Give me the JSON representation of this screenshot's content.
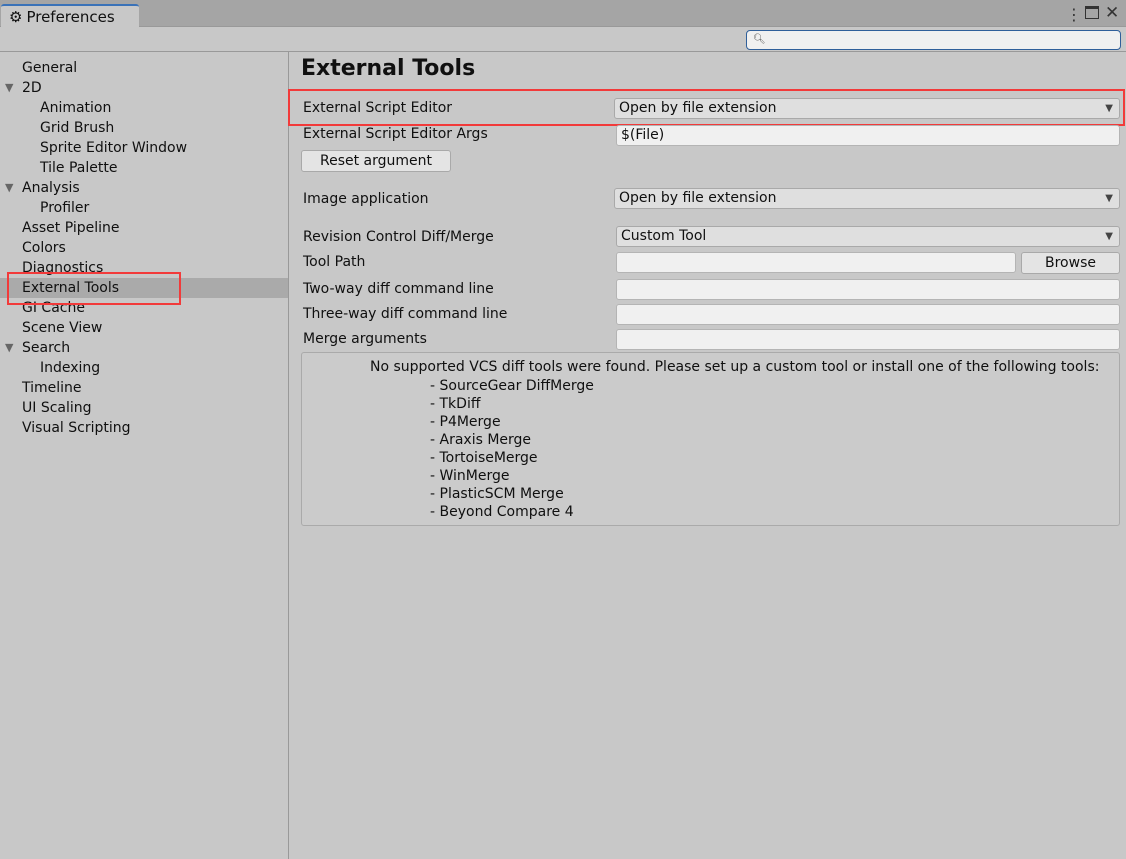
{
  "window": {
    "title": "Preferences",
    "icons": [
      "gear-icon",
      "more-icon",
      "maximize-icon",
      "close-icon"
    ]
  },
  "search": {
    "placeholder": "",
    "icon": "search-icon"
  },
  "sidebar": {
    "items": [
      {
        "label": "General",
        "indent": 0
      },
      {
        "label": "2D",
        "indent": 0,
        "expanded": true
      },
      {
        "label": "Animation",
        "indent": 1
      },
      {
        "label": "Grid Brush",
        "indent": 1
      },
      {
        "label": "Sprite Editor Window",
        "indent": 1
      },
      {
        "label": "Tile Palette",
        "indent": 1
      },
      {
        "label": "Analysis",
        "indent": 0,
        "expanded": true
      },
      {
        "label": "Profiler",
        "indent": 1
      },
      {
        "label": "Asset Pipeline",
        "indent": 0
      },
      {
        "label": "Colors",
        "indent": 0
      },
      {
        "label": "Diagnostics",
        "indent": 0
      },
      {
        "label": "External Tools",
        "indent": 0,
        "selected": true
      },
      {
        "label": "GI Cache",
        "indent": 0
      },
      {
        "label": "Scene View",
        "indent": 0
      },
      {
        "label": "Search",
        "indent": 0,
        "expanded": true
      },
      {
        "label": "Indexing",
        "indent": 1
      },
      {
        "label": "Timeline",
        "indent": 0
      },
      {
        "label": "UI Scaling",
        "indent": 0
      },
      {
        "label": "Visual Scripting",
        "indent": 0
      }
    ]
  },
  "main": {
    "title": "External Tools",
    "script_editor": {
      "label": "External Script Editor",
      "value": "Open by file extension"
    },
    "script_args": {
      "label": "External Script Editor Args",
      "value": "$(File)"
    },
    "reset_button": "Reset argument",
    "image_app": {
      "label": "Image application",
      "value": "Open by file extension"
    },
    "revision": {
      "label": "Revision Control Diff/Merge",
      "value": "Custom Tool"
    },
    "tool_path": {
      "label": "Tool Path",
      "value": "",
      "browse": "Browse"
    },
    "two_way": {
      "label": "Two-way diff command line",
      "value": ""
    },
    "three_way": {
      "label": "Three-way diff command line",
      "value": ""
    },
    "merge_args": {
      "label": "Merge arguments",
      "value": ""
    },
    "help": {
      "message": "No supported VCS diff tools were found. Please set up a custom tool or install one of the following tools:",
      "tools": [
        "- SourceGear DiffMerge",
        "- TkDiff",
        "- P4Merge",
        "- Araxis Merge",
        "- TortoiseMerge",
        "- WinMerge",
        "- PlasticSCM Merge",
        "- Beyond Compare 4"
      ]
    }
  },
  "colors": {
    "highlight": "#f23a3a",
    "accent": "#3a72b8",
    "selected": "#aaaaaa"
  }
}
